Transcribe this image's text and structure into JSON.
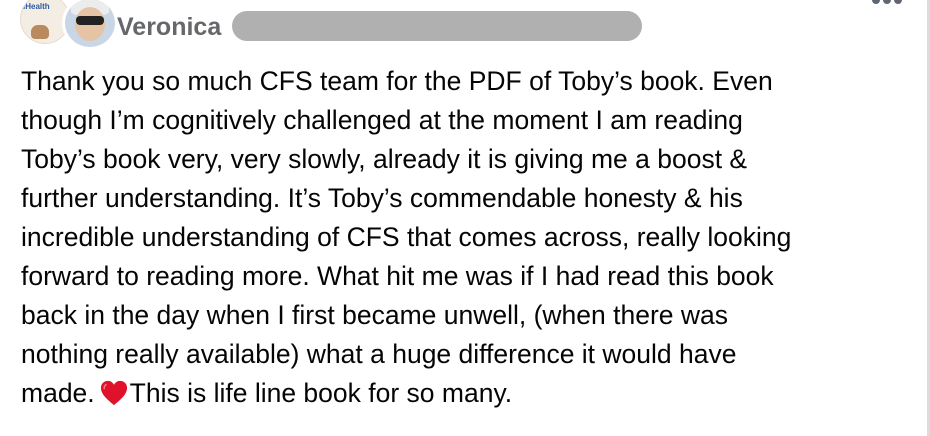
{
  "post": {
    "author_name": "Veronica",
    "avatar_badge_text": "iHealth",
    "body_lines": [
      "Thank you so much CFS team for the PDF of Toby’s book. Even",
      "though I’m cognitively challenged at the moment I am reading",
      "Toby’s book very, very slowly, already it is giving me a boost &",
      "further understanding. It’s Toby’s commendable honesty & his",
      "incredible understanding of CFS that comes across, really looking",
      "forward to reading more. What hit me was if I had read this book",
      "back in the day when I first became unwell, (when there was",
      "nothing really available) what a huge difference it would have"
    ],
    "body_last_line_before_emoji": "made.",
    "body_last_line_after_emoji": "This is life line book for so many.",
    "emoji": "red-heart-icon"
  },
  "colors": {
    "author_name": "#65676b",
    "body_text": "#050505",
    "redaction": "#b0b0b0",
    "heart": "#e0112b",
    "more_dots": "#606770"
  }
}
